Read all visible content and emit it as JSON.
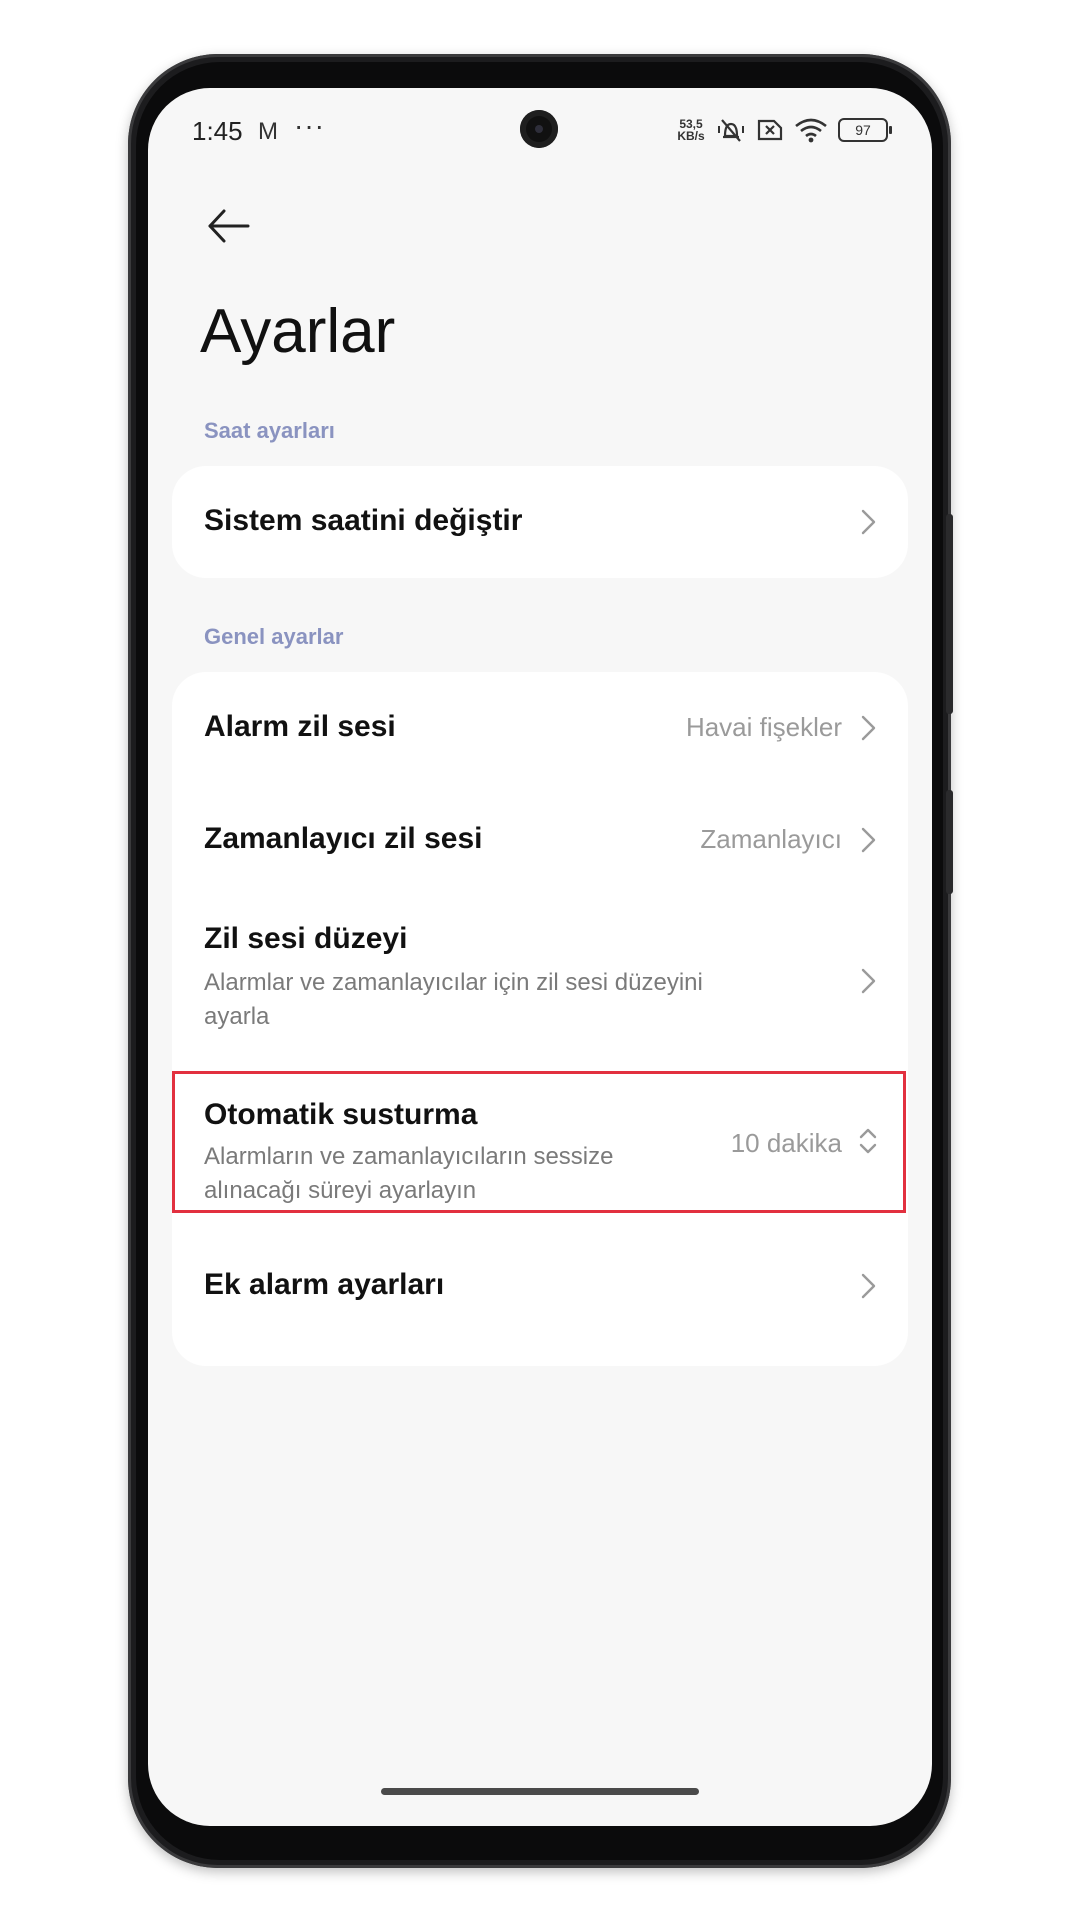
{
  "status_bar": {
    "time": "1:45",
    "mail_icon": "M",
    "more_dots": "···",
    "net_speed_value": "53,5",
    "net_speed_unit": "KB/s",
    "battery": "97",
    "icons": [
      "mail-icon",
      "more-icon",
      "vibrate-silent-icon",
      "sim-missing-icon",
      "wifi-icon",
      "battery-icon"
    ]
  },
  "header": {
    "back_icon": "arrow-left-icon",
    "title": "Ayarlar"
  },
  "sections": {
    "clock": {
      "label": "Saat ayarları",
      "items": [
        {
          "title": "Sistem saatini değiştir",
          "icon": "chevron-right-icon"
        }
      ]
    },
    "general": {
      "label": "Genel ayarlar",
      "items": [
        {
          "title": "Alarm zil sesi",
          "value": "Havai fişekler",
          "icon": "chevron-right-icon"
        },
        {
          "title": "Zamanlayıcı zil sesi",
          "value": "Zamanlayıcı",
          "icon": "chevron-right-icon"
        },
        {
          "title": "Zil sesi düzeyi",
          "description": "Alarmlar ve zamanlayıcılar için zil sesi düzeyini ayarla",
          "icon": "chevron-right-icon"
        },
        {
          "title": "Otomatik susturma",
          "description": "Alarmların ve zamanlayıcıların sessize alınacağı süreyi ayarlayın",
          "value": "10 dakika",
          "icon": "chevron-up-down-icon"
        },
        {
          "title": "Ek alarm ayarları",
          "icon": "chevron-right-icon"
        }
      ]
    }
  },
  "colors": {
    "section_label": "#8a93c0",
    "highlight": "#e2303f",
    "screen_bg": "#f7f7f7",
    "card_bg": "#ffffff"
  }
}
